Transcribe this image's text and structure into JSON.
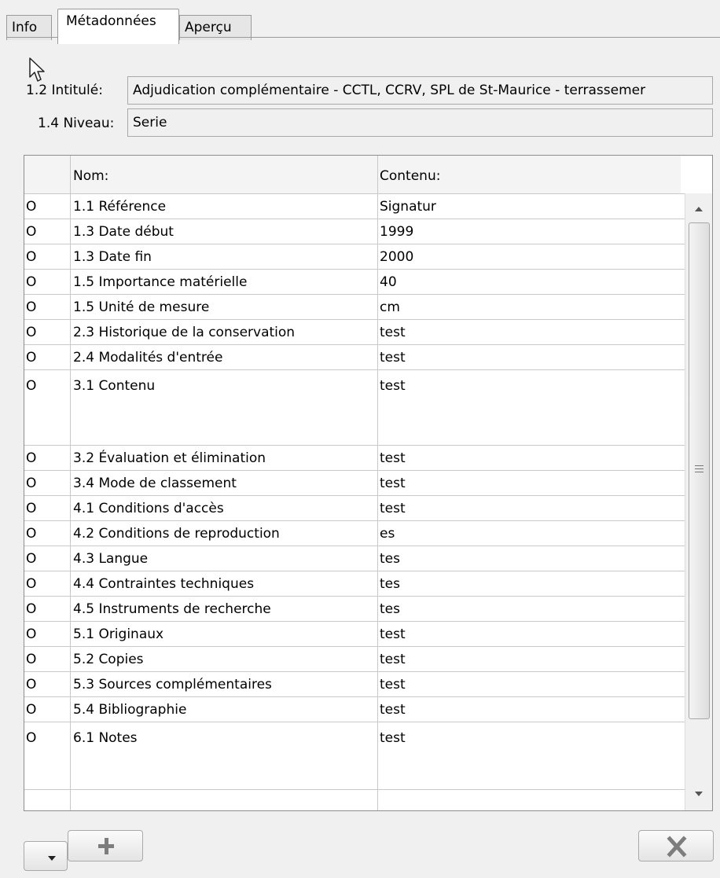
{
  "tabs": [
    "Info",
    "Métadonnées",
    "Aperçu"
  ],
  "fields": [
    {
      "label": "1.2 Intitulé:",
      "value": "Adjudication complémentaire - CCTL, CCRV, SPL de St-Maurice - terrassemer"
    },
    {
      "label": "1.4 Niveau:",
      "value": "Serie"
    }
  ],
  "table": {
    "headers": [
      "",
      "Nom:",
      "Contenu:"
    ],
    "rows": [
      {
        "mark": "O",
        "name": "1.1 Référence",
        "value": "Signatur"
      },
      {
        "mark": "O",
        "name": "1.3 Date début",
        "value": "1999"
      },
      {
        "mark": "O",
        "name": "1.3 Date fin",
        "value": "2000"
      },
      {
        "mark": "O",
        "name": "1.5 Importance matérielle",
        "value": "40"
      },
      {
        "mark": "O",
        "name": "1.5 Unité de mesure",
        "value": "cm"
      },
      {
        "mark": "O",
        "name": "2.3 Historique de la conservation",
        "value": "test"
      },
      {
        "mark": "O",
        "name": "2.4 Modalités d'entrée",
        "value": "test"
      },
      {
        "mark": "O",
        "name": "3.1 Contenu",
        "value": "test"
      },
      {
        "mark": "O",
        "name": "3.2 Évaluation et élimination",
        "value": "test"
      },
      {
        "mark": "O",
        "name": "3.4 Mode de classement",
        "value": "test"
      },
      {
        "mark": "O",
        "name": "4.1 Conditions d'accès",
        "value": "test"
      },
      {
        "mark": "O",
        "name": "4.2 Conditions de reproduction",
        "value": "es"
      },
      {
        "mark": "O",
        "name": "4.3 Langue",
        "value": "tes"
      },
      {
        "mark": "O",
        "name": "4.4 Contraintes techniques",
        "value": "tes"
      },
      {
        "mark": "O",
        "name": "4.5 Instruments de recherche",
        "value": "tes"
      },
      {
        "mark": "O",
        "name": "5.1 Originaux",
        "value": "test"
      },
      {
        "mark": "O",
        "name": "5.2 Copies",
        "value": "test"
      },
      {
        "mark": "O",
        "name": "5.3 Sources complémentaires",
        "value": "test"
      },
      {
        "mark": "O",
        "name": "5.4 Bibliographie",
        "value": "test"
      },
      {
        "mark": "O",
        "name": "6.1 Notes",
        "value": "test"
      }
    ]
  },
  "buttons": {
    "dropdown_icon": "chevron-down-icon",
    "add_icon": "plus-icon",
    "delete_icon": "close-icon"
  }
}
